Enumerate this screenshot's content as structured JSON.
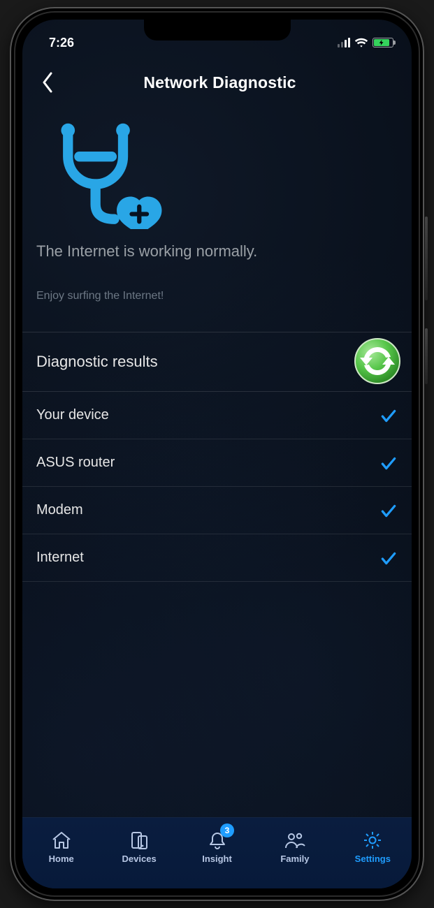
{
  "status": {
    "time": "7:26"
  },
  "header": {
    "title": "Network Diagnostic"
  },
  "hero": {
    "status_text": "The Internet is working normally.",
    "sub_text": "Enjoy surfing the Internet!"
  },
  "results": {
    "heading": "Diagnostic results",
    "items": [
      {
        "label": "Your device",
        "ok": true
      },
      {
        "label": "ASUS router",
        "ok": true
      },
      {
        "label": "Modem",
        "ok": true
      },
      {
        "label": "Internet",
        "ok": true
      }
    ]
  },
  "tabs": {
    "items": [
      {
        "label": "Home",
        "icon": "home-icon"
      },
      {
        "label": "Devices",
        "icon": "devices-icon"
      },
      {
        "label": "Insight",
        "icon": "bell-icon",
        "badge": "3"
      },
      {
        "label": "Family",
        "icon": "family-icon"
      },
      {
        "label": "Settings",
        "icon": "gear-icon",
        "active": true
      }
    ]
  },
  "colors": {
    "accent": "#1f9dff",
    "icon_blue": "#29a6e6",
    "ok_green": "#4fb24f"
  }
}
